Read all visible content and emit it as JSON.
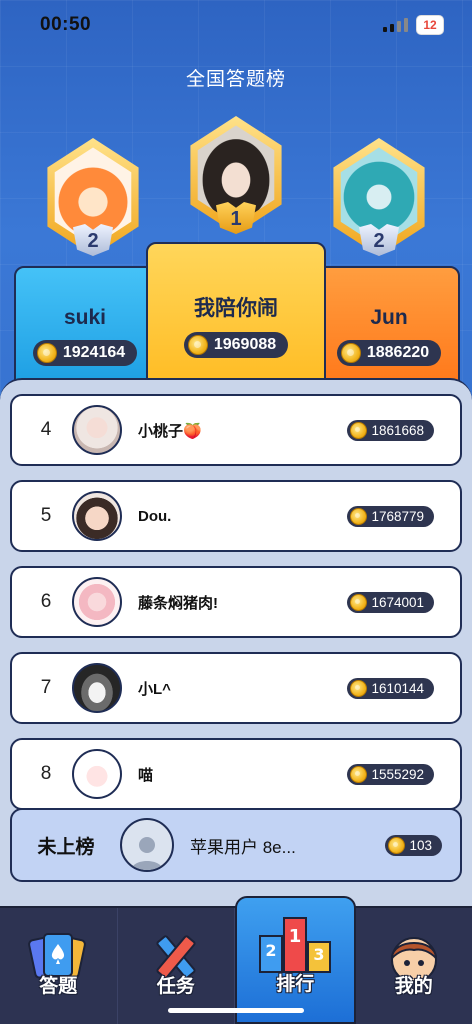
{
  "status_bar": {
    "time": "00:50",
    "battery": "12"
  },
  "page_title": "全国答题榜",
  "podium": {
    "first": {
      "rank": "1",
      "name": "我陪你闹",
      "score": "1969088"
    },
    "second_left": {
      "rank": "2",
      "name": "suki",
      "score": "1924164"
    },
    "second_right": {
      "rank": "2",
      "name": "Jun",
      "score": "1886220"
    }
  },
  "rankings": [
    {
      "rank": "4",
      "name": "小桃子🍑",
      "score": "1861668"
    },
    {
      "rank": "5",
      "name": "Dou.",
      "score": "1768779"
    },
    {
      "rank": "6",
      "name": "藤条焖猪肉!",
      "score": "1674001"
    },
    {
      "rank": "7",
      "name": "小L^",
      "score": "1610144"
    },
    {
      "rank": "8",
      "name": "喵",
      "score": "1555292"
    }
  ],
  "my_rank": {
    "label": "未上榜",
    "name": "苹果用户 8e...",
    "score": "103"
  },
  "tabs": [
    {
      "label": "答题",
      "icon": "cards-icon"
    },
    {
      "label": "任务",
      "icon": "pencils-icon"
    },
    {
      "label": "排行",
      "icon": "podium-icon"
    },
    {
      "label": "我的",
      "icon": "profile-icon"
    }
  ],
  "colors": {
    "background": "#2e64c2",
    "podium_left": "#2fb0ef",
    "podium_center": "#ffc83a",
    "podium_right": "#ff8a2e",
    "accent_gold": "#f2b51e",
    "tab_active": "#2a86e6"
  }
}
